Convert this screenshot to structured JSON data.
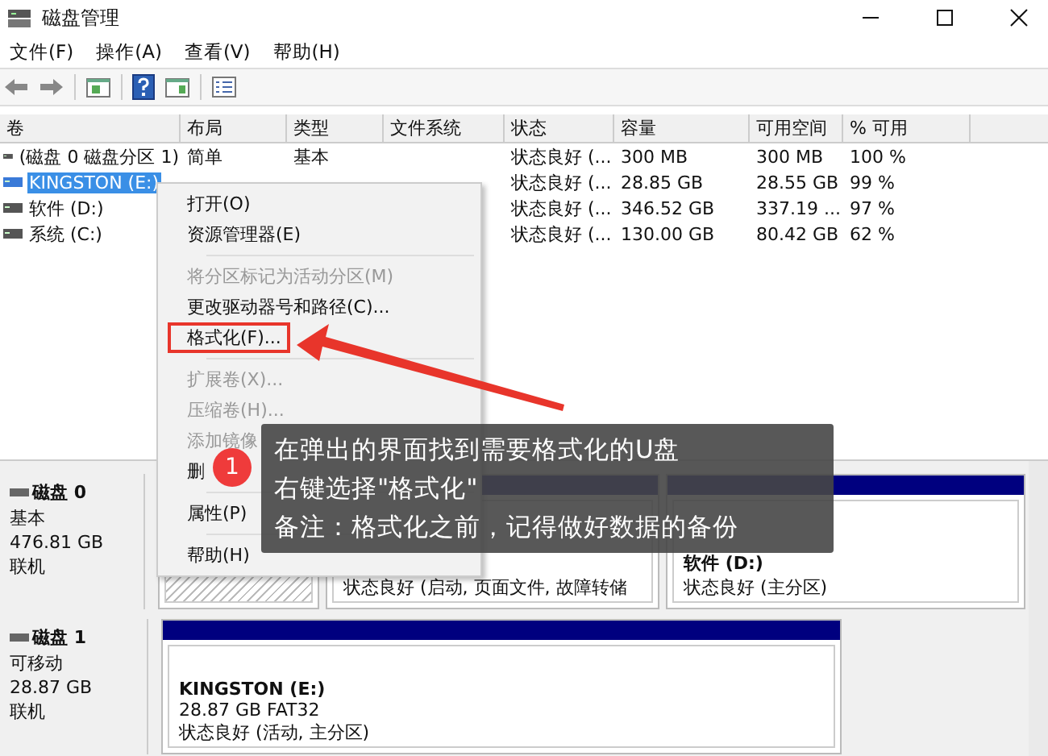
{
  "window": {
    "title": "磁盘管理"
  },
  "menu": [
    "文件(F)",
    "操作(A)",
    "查看(V)",
    "帮助(H)"
  ],
  "table": {
    "columns": [
      "卷",
      "布局",
      "类型",
      "文件系统",
      "状态",
      "容量",
      "可用空间",
      "% 可用"
    ],
    "rows": [
      {
        "selected": false,
        "cells": [
          "(磁盘 0 磁盘分区 1)",
          "简单",
          "基本",
          "",
          "状态良好 (...",
          "300 MB",
          "300 MB",
          "100 %"
        ]
      },
      {
        "selected": true,
        "cells": [
          "KINGSTON (E:)",
          "",
          "",
          "",
          "状态良好 (...",
          "28.85 GB",
          "28.55 GB",
          "99 %"
        ]
      },
      {
        "selected": false,
        "cells": [
          "软件 (D:)",
          "",
          "",
          "",
          "状态良好 (...",
          "346.52 GB",
          "337.19 ...",
          "97 %"
        ]
      },
      {
        "selected": false,
        "cells": [
          "系统 (C:)",
          "",
          "",
          "",
          "状态良好 (...",
          "130.00 GB",
          "80.42 GB",
          "62 %"
        ]
      }
    ]
  },
  "disks": [
    {
      "name": "磁盘 0",
      "type": "基本",
      "size": "476.81 GB",
      "status": "联机",
      "partitions": [
        {
          "kind": "hatched"
        },
        {
          "kind": "plain",
          "status": "状态良好 (启动, 页面文件, 故障转储"
        },
        {
          "kind": "plain",
          "name": "软件 (D:)",
          "status": "状态良好 (主分区)"
        }
      ]
    },
    {
      "name": "磁盘 1",
      "type": "可移动",
      "size": "28.87 GB",
      "status": "联机",
      "partitions": [
        {
          "kind": "plain",
          "name": "KINGSTON  (E:)",
          "detail": "28.87 GB FAT32",
          "status": "状态良好 (活动, 主分区)"
        }
      ]
    }
  ],
  "context_menu": [
    {
      "kind": "item",
      "label": "打开(O)",
      "disabled": false,
      "highlighted": false
    },
    {
      "kind": "item",
      "label": "资源管理器(E)",
      "disabled": false,
      "highlighted": false
    },
    {
      "kind": "separator"
    },
    {
      "kind": "item",
      "label": "将分区标记为活动分区(M)",
      "disabled": true,
      "highlighted": false
    },
    {
      "kind": "item",
      "label": "更改驱动器号和路径(C)...",
      "disabled": false,
      "highlighted": false
    },
    {
      "kind": "item",
      "label": "格式化(F)...",
      "disabled": false,
      "highlighted": true
    },
    {
      "kind": "separator"
    },
    {
      "kind": "item",
      "label": "扩展卷(X)...",
      "disabled": true,
      "highlighted": false
    },
    {
      "kind": "item",
      "label": "压缩卷(H)...",
      "disabled": true,
      "highlighted": false
    },
    {
      "kind": "item",
      "label": "添加镜像",
      "disabled": true,
      "highlighted": false
    },
    {
      "kind": "item",
      "label": "删",
      "disabled": false,
      "highlighted": false
    },
    {
      "kind": "separator"
    },
    {
      "kind": "item",
      "label": "属性(P)",
      "disabled": false,
      "highlighted": false
    },
    {
      "kind": "separator"
    },
    {
      "kind": "item",
      "label": "帮助(H)",
      "disabled": false,
      "highlighted": false
    }
  ],
  "callout": {
    "badge": "1",
    "lines": [
      "在弹出的界面找到需要格式化的U盘",
      "右键选择\"格式化\"",
      "备注：格式化之前，记得做好数据的备份"
    ]
  }
}
